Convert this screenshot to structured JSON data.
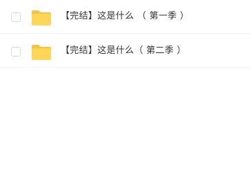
{
  "files": [
    {
      "name": "【完结】这是什么 （ 第一季 ）",
      "icon": "folder-icon",
      "checked": false
    },
    {
      "name": "【完结】这是什么（ 第二季 ）",
      "icon": "folder-icon",
      "checked": false
    }
  ],
  "colors": {
    "folder": "#FFD658",
    "folder_tab": "#F5C447",
    "checkbox_border": "#d6d9de",
    "divider": "#f1f2f4",
    "text": "#333333"
  }
}
